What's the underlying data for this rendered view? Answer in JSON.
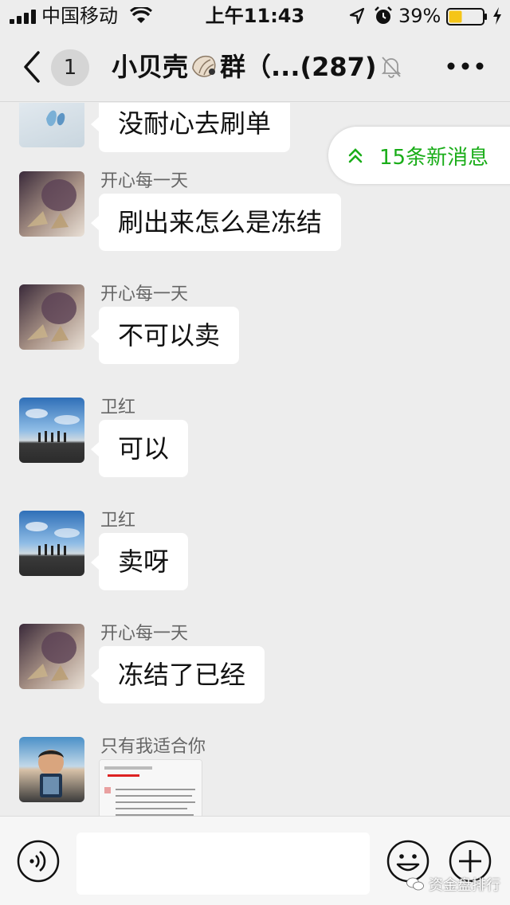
{
  "status_bar": {
    "carrier": "中国移动",
    "time": "上午11:43",
    "battery_pct": "39%",
    "battery_level": 0.39
  },
  "nav": {
    "badge": "1",
    "title_prefix": "小贝壳",
    "title_suffix": "群（...(287)",
    "back_icon": "chevron-left-icon",
    "more_icon": "ellipsis-icon",
    "mute_icon": "bell-off-icon"
  },
  "new_messages": {
    "label": "15条新消息",
    "color": "#1aad19"
  },
  "messages": [
    {
      "sender": "",
      "text": "没耐心去刷单"
    },
    {
      "sender": "开心每一天",
      "text": "刷出来怎么是冻结"
    },
    {
      "sender": "开心每一天",
      "text": "不可以卖"
    },
    {
      "sender": "卫红",
      "text": "可以"
    },
    {
      "sender": "卫红",
      "text": "卖呀"
    },
    {
      "sender": "开心每一天",
      "text": "冻结了已经"
    },
    {
      "sender": "只有我适合你",
      "text": ""
    }
  ],
  "input": {
    "value": ""
  },
  "watermark": "资金盘排行"
}
